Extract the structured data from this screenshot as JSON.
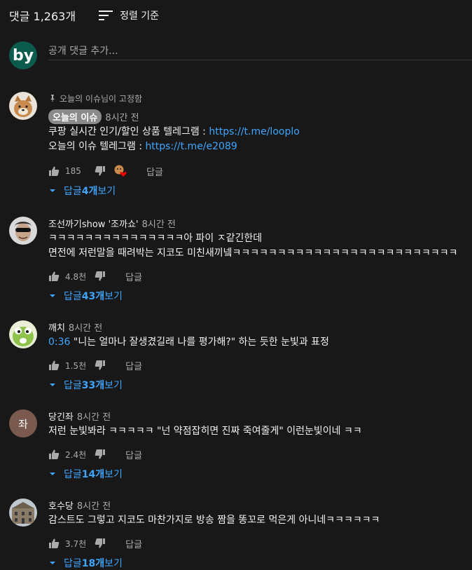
{
  "header": {
    "comment_count": "댓글 1,263개",
    "sort_label": "정렬 기준",
    "sort_icon": "sort-icon"
  },
  "add_comment": {
    "avatar_text": "by",
    "placeholder": "공개 댓글 추가..."
  },
  "pinned": {
    "pin_text": "오늘의 이슈님이 고정함",
    "author": "오늘의 이슈",
    "time": "8시간 전",
    "line1_text": "쿠팡 실시간 인기/할인 상품 텔레그램 : ",
    "line1_link": "https://t.me/looplo",
    "line2_text": "오늘의 이슈 텔레그램 : ",
    "line2_link": "https://t.me/e2089",
    "likes": "185",
    "reply": "답글",
    "replies_prefix": "답글 ",
    "replies_count": "4개",
    "replies_suffix": " 보기"
  },
  "comments": [
    {
      "author": "조선까기show '조까쇼'",
      "time": "8시간 전",
      "timestamp": "",
      "lines": [
        "ㅋㅋㅋㅋㅋㅋㅋㅋㅋㅋㅋㅋㅋㅋㅋ아 파이 ㅈ같긴한데",
        "면전에 저런말을 때려박는 지코도 미친새끼넼ㅋㅋㅋㅋㅋㅋㅋㅋㅋㅋㅋㅋㅋㅋㅋㅋㅋㅋㅋㅋㅋㅋㅋㅋㅋ"
      ],
      "likes": "4.8천",
      "reply": "답글",
      "replies_prefix": "답글 ",
      "replies_count": "43개",
      "replies_suffix": " 보기"
    },
    {
      "author": "깨치",
      "time": "8시간 전",
      "timestamp": "0:36",
      "lines": [
        " \"니는 얼마나 잘생겼길래 나를 평가해?\" 하는 듯한 눈빛과 표정"
      ],
      "likes": "1.5천",
      "reply": "답글",
      "replies_prefix": "답글 ",
      "replies_count": "33개",
      "replies_suffix": " 보기"
    },
    {
      "author": "당긴좌",
      "avatar_letter": "좌",
      "time": "8시간 전",
      "timestamp": "",
      "lines": [
        "저런 눈빛봐라 ㅋㅋㅋㅋㅋ \"넌 약점잡히면 진짜 죽여줄게\" 이런눈빛이네 ㅋㅋ"
      ],
      "likes": "2.4천",
      "reply": "답글",
      "replies_prefix": "답글 ",
      "replies_count": "14개",
      "replies_suffix": " 보기"
    },
    {
      "author": "호수당",
      "time": "8시간 전",
      "timestamp": "",
      "lines": [
        "감스트도 그렇고 지코도 마찬가지로 방송 짬을 똥꼬로 먹은게 아니네ㅋㅋㅋㅋㅋㅋ"
      ],
      "likes": "3.7천",
      "reply": "답글",
      "replies_prefix": "답글 ",
      "replies_count": "18개",
      "replies_suffix": " 보기"
    }
  ],
  "colors": {
    "background": "#181818",
    "link": "#3ea6ff",
    "muted": "#aaaaaa",
    "badge": "#8a8a8a",
    "my_avatar": "#0b5c4c",
    "letter_avatar": "#7a5a4e"
  }
}
